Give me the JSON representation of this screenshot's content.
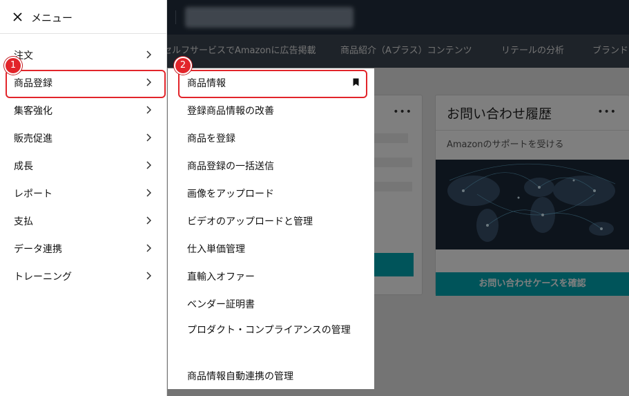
{
  "background": {
    "nav_links": [
      "セルフサービスでAmazonに広告掲載",
      "商品紹介（Aプラス）コンテンツ",
      "リテールの分析",
      "ブランド"
    ],
    "contact_card": {
      "title": "お問い合わせ履歴",
      "subtitle": "Amazonのサポートを受ける",
      "button_label": "お問い合わせケースを確認",
      "more_label": "•••"
    },
    "left_card": {
      "more_label": "•••"
    }
  },
  "menu": {
    "title": "メニュー",
    "close_icon": "close-icon",
    "items": [
      {
        "label": "注文"
      },
      {
        "label": "商品登録"
      },
      {
        "label": "集客強化"
      },
      {
        "label": "販売促進"
      },
      {
        "label": "成長"
      },
      {
        "label": "レポート"
      },
      {
        "label": "支払"
      },
      {
        "label": "データ連携"
      },
      {
        "label": "トレーニング"
      }
    ]
  },
  "submenu": {
    "items": [
      {
        "label": "商品情報"
      },
      {
        "label": "登録商品情報の改善"
      },
      {
        "label": "商品を登録"
      },
      {
        "label": "商品登録の一括送信"
      },
      {
        "label": "画像をアップロード"
      },
      {
        "label": "ビデオのアップロードと管理"
      },
      {
        "label": "仕入単価管理"
      },
      {
        "label": "直輸入オファー"
      },
      {
        "label": "ベンダー証明書"
      },
      {
        "label": "プロダクト・コンプライアンスの管理"
      },
      {
        "label": "商品情報自動連携の管理"
      }
    ]
  },
  "annotations": {
    "badge_1": "1",
    "badge_2": "2",
    "highlight_color": "#e2242a"
  }
}
